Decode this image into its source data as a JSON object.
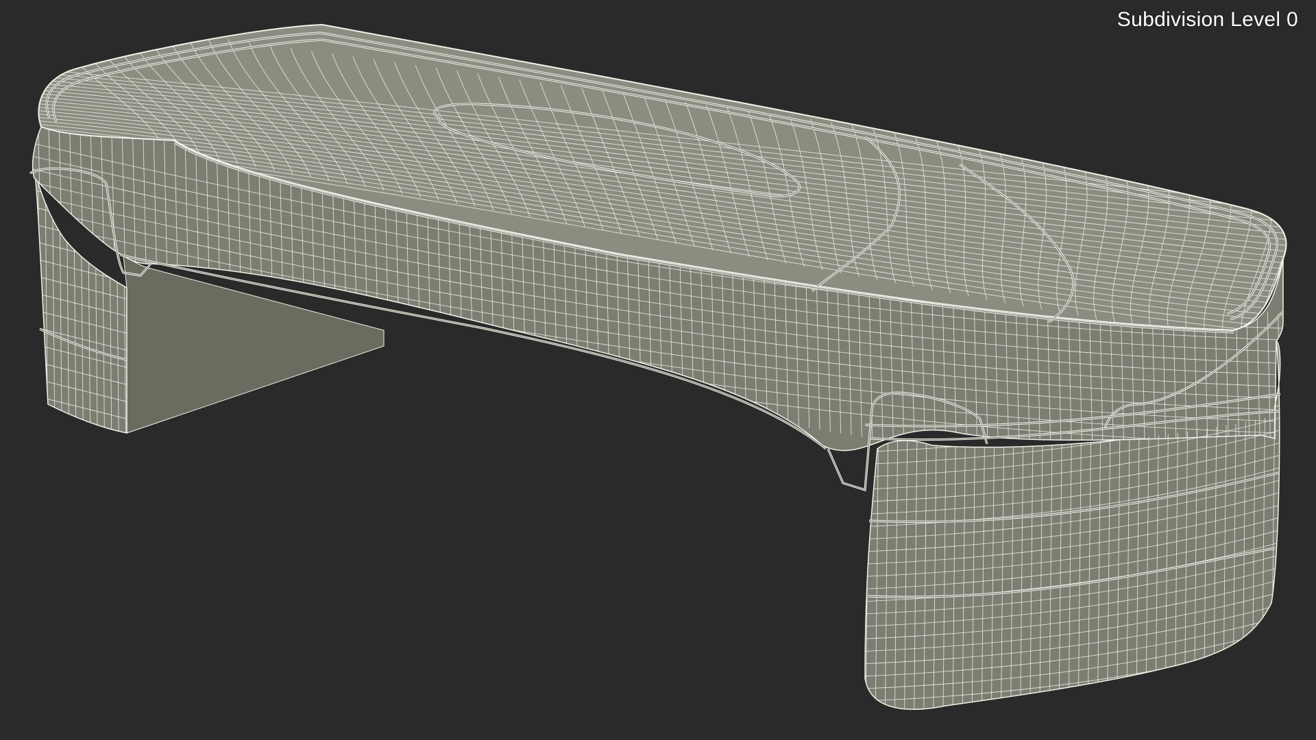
{
  "viewport": {
    "label": "Subdivision Level 0",
    "background_color": "#2a2a2a",
    "model_fill_color": "#7d7e72",
    "model_shade_color": "#6b6c60",
    "model_light_color": "#8c8d81",
    "wire_color": "#f2f2ea",
    "subject": "aerobic step platform wireframe"
  }
}
